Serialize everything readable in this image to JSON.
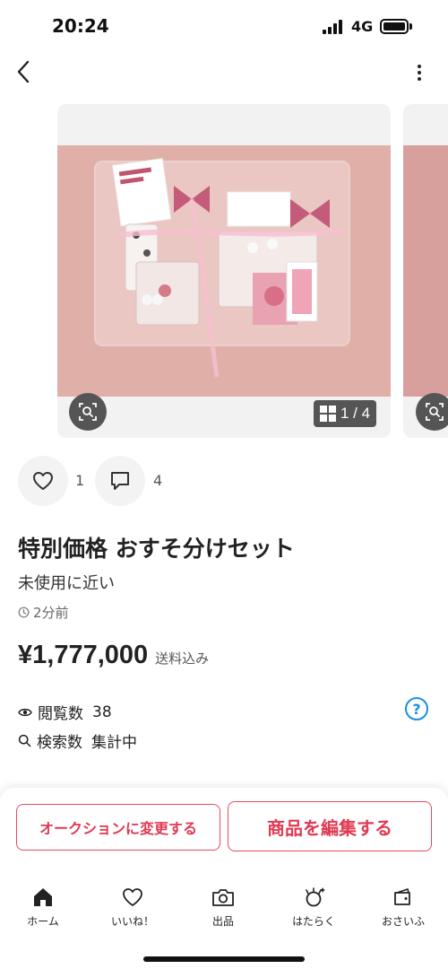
{
  "status_bar": {
    "time": "20:24",
    "network": "4G"
  },
  "gallery": {
    "counter": "1 / 4"
  },
  "actions": {
    "like_count": "1",
    "comment_count": "4"
  },
  "item": {
    "title": "特別価格 おすそ分けセット",
    "condition": "未使用に近い",
    "posted": "2分前",
    "price": "¥1,777,000",
    "shipping": "送料込み"
  },
  "stats": {
    "views_label": "閲覧数",
    "views_value": "38",
    "search_label": "検索数",
    "search_value": "集計中"
  },
  "buttons": {
    "auction": "オークションに変更する",
    "edit": "商品を編集する"
  },
  "tabs": [
    {
      "label": "ホーム",
      "icon": "home-icon"
    },
    {
      "label": "いいね！",
      "icon": "heart-icon"
    },
    {
      "label": "出品",
      "icon": "camera-icon"
    },
    {
      "label": "はたらく",
      "icon": "work-icon"
    },
    {
      "label": "おさいふ",
      "icon": "wallet-icon"
    }
  ],
  "colors": {
    "accent": "#e84a5f",
    "link": "#1a8fe3"
  }
}
